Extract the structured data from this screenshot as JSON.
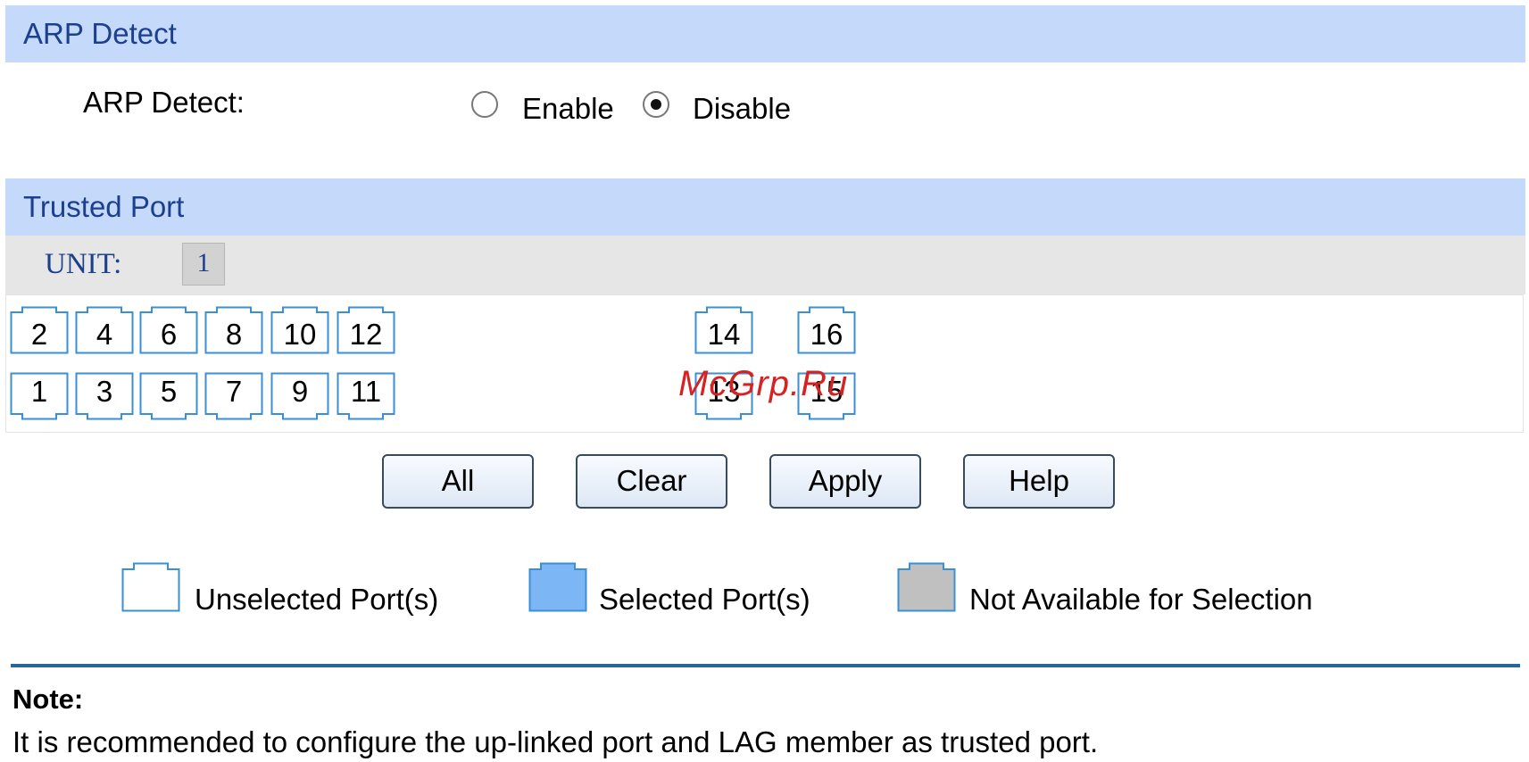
{
  "arp_section": {
    "header": "ARP Detect",
    "field_label": "ARP Detect:",
    "options": [
      {
        "label": "Enable",
        "checked": false
      },
      {
        "label": "Disable",
        "checked": true
      }
    ]
  },
  "trusted_section": {
    "header": "Trusted Port",
    "unit_label": "UNIT:",
    "unit_value": "1",
    "ports_top": [
      "2",
      "4",
      "6",
      "8",
      "10",
      "12",
      "14",
      "16"
    ],
    "ports_bottom": [
      "1",
      "3",
      "5",
      "7",
      "9",
      "11",
      "13",
      "15"
    ],
    "port_state": "unselected"
  },
  "buttons": {
    "all": "All",
    "clear": "Clear",
    "apply": "Apply",
    "help": "Help"
  },
  "legend": {
    "unselected": "Unselected Port(s)",
    "selected": "Selected Port(s)",
    "not_available": "Not Available for Selection"
  },
  "colors": {
    "header_bg": "#c5d9fb",
    "header_text": "#1c3f8e",
    "port_outline": "#3b8fd6",
    "selected_fill": "#7db6f5",
    "not_available_fill": "#c0c0c0",
    "divider": "#23679d"
  },
  "note": {
    "title": "Note:",
    "text": "It is recommended to configure the up-linked port and LAG member as trusted port."
  },
  "watermark": "McGrp.Ru"
}
